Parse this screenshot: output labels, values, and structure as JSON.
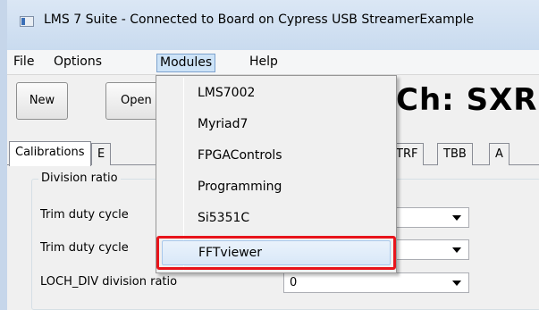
{
  "window": {
    "title": "LMS 7 Suite - Connected to Board on Cypress USB StreamerExample",
    "icon": "app-icon"
  },
  "menubar": {
    "items": [
      "File",
      "Options",
      "Modules",
      "Help"
    ],
    "active": "Modules"
  },
  "toolbar": {
    "new_label": "New",
    "open_label": "Open",
    "channel_label": "Ch: SXR"
  },
  "tabs": [
    "Calibrations",
    "E",
    "TRF",
    "TBB",
    "A"
  ],
  "group": {
    "title": "Division ratio",
    "rows": [
      {
        "label": "Trim duty cycle",
        "value": ""
      },
      {
        "label": "Trim duty cycle",
        "value": ""
      },
      {
        "label": "LOCH_DIV division ratio",
        "value": "0"
      }
    ]
  },
  "modules_menu": {
    "items": [
      "LMS7002",
      "Myriad7",
      "FPGAControls",
      "Programming",
      "Si5351C",
      "FFTviewer"
    ],
    "highlighted": "FFTviewer",
    "highlight_color": "#e8141b"
  }
}
